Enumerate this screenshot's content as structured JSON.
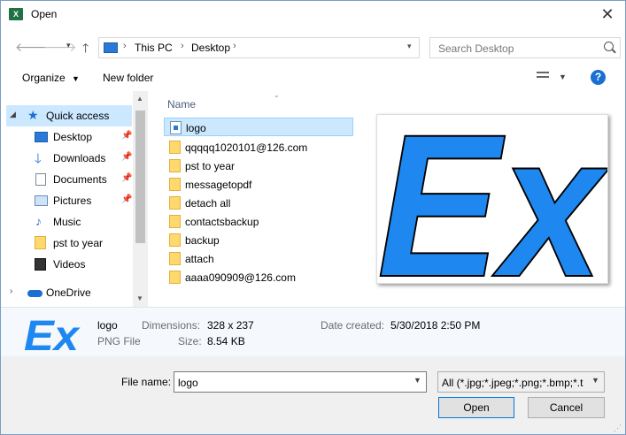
{
  "window": {
    "title": "Open",
    "app_icon": "X"
  },
  "nav": {
    "back_icon": "back-arrow-icon",
    "breadcrumb": [
      "This PC",
      "Desktop"
    ],
    "search_placeholder": "Search Desktop"
  },
  "toolbar": {
    "organize": "Organize",
    "new_folder": "New folder"
  },
  "sidebar": {
    "quick_access": "Quick access",
    "items": [
      {
        "label": "Desktop",
        "icon": "desktop-icon"
      },
      {
        "label": "Downloads",
        "icon": "downloads-icon"
      },
      {
        "label": "Documents",
        "icon": "documents-icon"
      },
      {
        "label": "Pictures",
        "icon": "pictures-icon"
      },
      {
        "label": "Music",
        "icon": "music-icon"
      },
      {
        "label": "pst to year",
        "icon": "folder-icon"
      },
      {
        "label": "Videos",
        "icon": "videos-icon"
      }
    ],
    "onedrive": "OneDrive"
  },
  "files": {
    "column_name": "Name",
    "rows": [
      {
        "name": "logo",
        "type": "image",
        "selected": true
      },
      {
        "name": "qqqqq1020101@126.com",
        "type": "folder"
      },
      {
        "name": "pst to year",
        "type": "folder"
      },
      {
        "name": "messagetopdf",
        "type": "folder"
      },
      {
        "name": "detach all",
        "type": "folder"
      },
      {
        "name": "contactsbackup",
        "type": "folder"
      },
      {
        "name": "backup",
        "type": "folder"
      },
      {
        "name": "attach",
        "type": "folder"
      },
      {
        "name": "aaaa090909@126.com",
        "type": "folder"
      }
    ]
  },
  "preview": {
    "logo_text": "Ex"
  },
  "details": {
    "name": "logo",
    "type": "PNG File",
    "dimensions_label": "Dimensions:",
    "dimensions": "328 x 237",
    "size_label": "Size:",
    "size": "8.54 KB",
    "date_label": "Date created:",
    "date": "5/30/2018 2:50 PM"
  },
  "footer": {
    "file_name_label": "File name:",
    "file_name_value": "logo",
    "filter": "All (*.jpg;*.jpeg;*.png;*.bmp;*.t",
    "open": "Open",
    "cancel": "Cancel"
  },
  "colors": {
    "accent": "#0078d7",
    "selection": "#cce8ff",
    "logo_blue": "#1e88f0"
  }
}
